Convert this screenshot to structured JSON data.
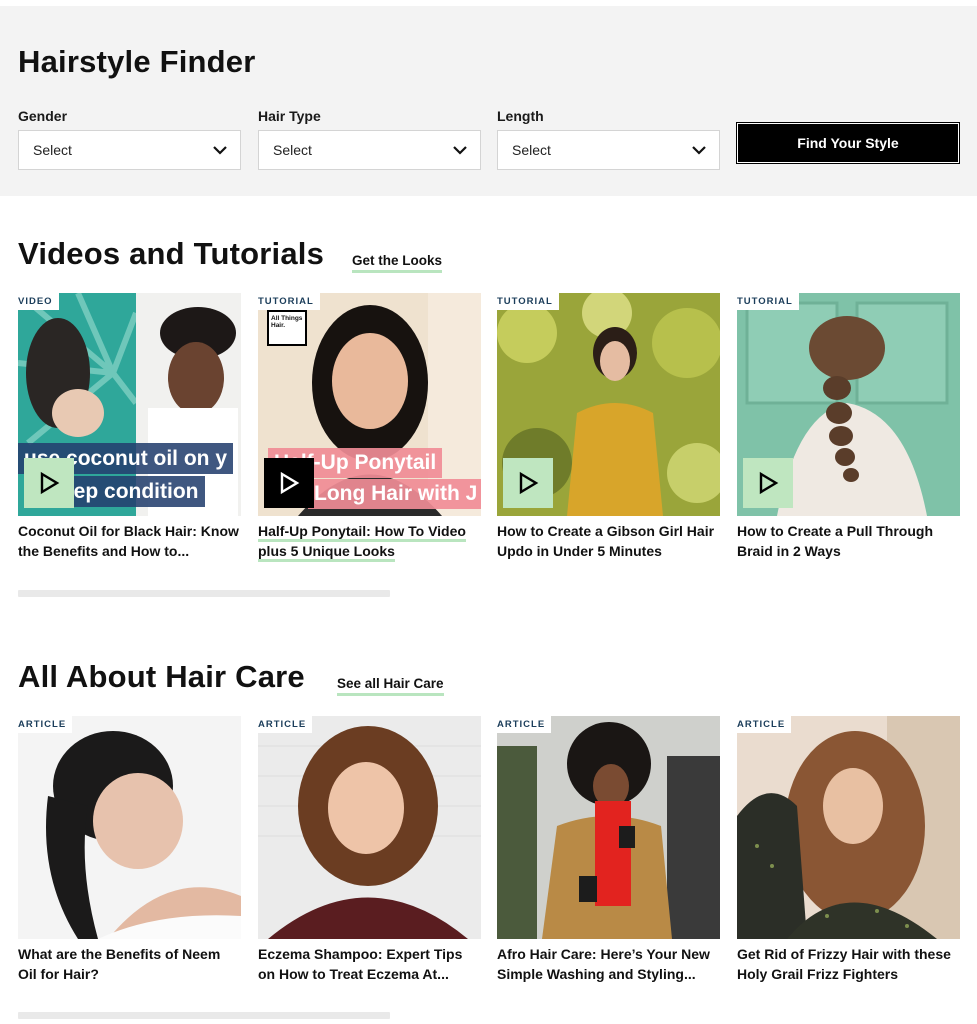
{
  "finder": {
    "title": "Hairstyle Finder",
    "filters": [
      {
        "label": "Gender",
        "value": "Select"
      },
      {
        "label": "Hair Type",
        "value": "Select"
      },
      {
        "label": "Length",
        "value": "Select"
      }
    ],
    "button_label": "Find Your Style"
  },
  "videos": {
    "title": "Videos and Tutorials",
    "link": "Get the Looks",
    "cards": [
      {
        "badge": "VIDEO",
        "title": "Coconut Oil for Black Hair: Know the Benefits and How to...",
        "overlay_1": "use coconut oil on y",
        "overlay_2": "eep condition"
      },
      {
        "badge": "TUTORIAL",
        "title": "Half-Up Ponytail: How To Video plus 5 Unique Looks",
        "overlay_1": "Half-Up Ponytail",
        "overlay_2": "Long Hair with J",
        "logo": "All Things Hair."
      },
      {
        "badge": "TUTORIAL",
        "title": "How to Create a Gibson Girl Hair Updo in Under 5 Minutes"
      },
      {
        "badge": "TUTORIAL",
        "title": "How to Create a Pull Through Braid in 2 Ways"
      }
    ]
  },
  "haircare": {
    "title": "All About Hair Care",
    "link": "See all Hair Care",
    "cards": [
      {
        "badge": "ARTICLE",
        "title": "What are the Benefits of Neem Oil for Hair?"
      },
      {
        "badge": "ARTICLE",
        "title": "Eczema Shampoo: Expert Tips on How to Treat Eczema At..."
      },
      {
        "badge": "ARTICLE",
        "title": "Afro Hair Care: Here’s Your New Simple Washing and Styling..."
      },
      {
        "badge": "ARTICLE",
        "title": "Get Rid of Frizzy Hair with these Holy Grail Frizz Fighters"
      }
    ]
  },
  "colors": {
    "accent_underline": "#b9e5bf",
    "play_button": "#bfe6c0",
    "badge_text": "#1b3d5a",
    "panel_bg": "#f3f3f3"
  },
  "icons": [
    "chevron-down-icon",
    "play-icon"
  ]
}
